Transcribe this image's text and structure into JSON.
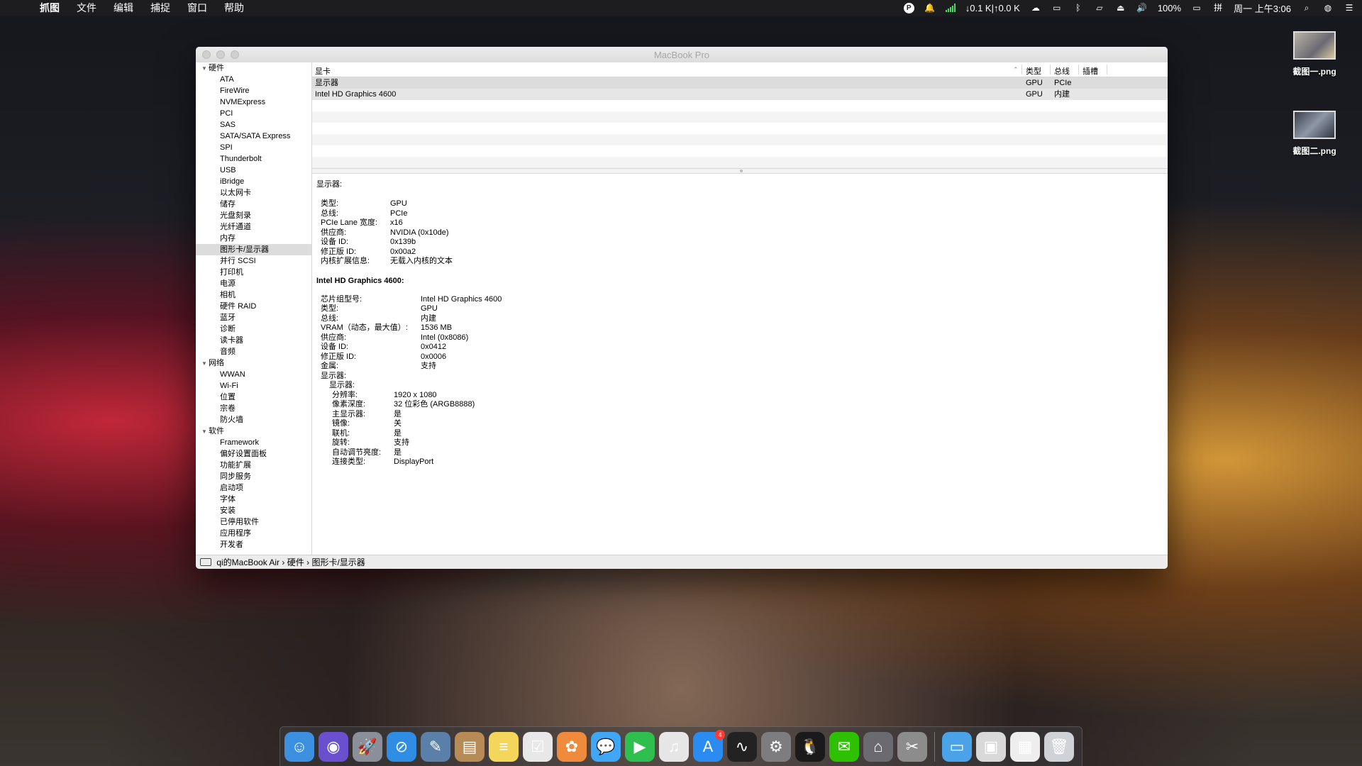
{
  "menubar": {
    "app": "抓图",
    "menus": [
      "文件",
      "编辑",
      "捕捉",
      "窗口",
      "帮助"
    ],
    "network": "↓0.1 K|↑0.0 K",
    "battery": "100%",
    "clock": "周一 上午3:06"
  },
  "desktop": {
    "files": [
      "截图一.png",
      "截图二.png"
    ]
  },
  "window": {
    "title": "MacBook Pro",
    "sidebar": {
      "groups": [
        {
          "label": "硬件",
          "items": [
            "ATA",
            "FireWire",
            "NVMExpress",
            "PCI",
            "SAS",
            "SATA/SATA Express",
            "SPI",
            "Thunderbolt",
            "USB",
            "iBridge",
            "以太网卡",
            "储存",
            "光盘刻录",
            "光纤通道",
            "内存",
            "图形卡/显示器",
            "并行 SCSI",
            "打印机",
            "电源",
            "相机",
            "硬件 RAID",
            "蓝牙",
            "诊断",
            "读卡器",
            "音频"
          ]
        },
        {
          "label": "网络",
          "items": [
            "WWAN",
            "Wi-Fi",
            "位置",
            "宗卷",
            "防火墙"
          ]
        },
        {
          "label": "软件",
          "items": [
            "Framework",
            "偏好设置面板",
            "功能扩展",
            "同步服务",
            "启动项",
            "字体",
            "安装",
            "已停用软件",
            "应用程序",
            "开发者"
          ]
        }
      ],
      "selected": "图形卡/显示器"
    },
    "table": {
      "headers": {
        "name": "显卡",
        "type": "类型",
        "bus": "总线",
        "slot": "插槽"
      },
      "rows": [
        {
          "name": "显示器",
          "type": "GPU",
          "bus": "PCIe"
        },
        {
          "name": "Intel HD Graphics 4600",
          "type": "GPU",
          "bus": "内建"
        }
      ]
    },
    "detail": {
      "section1_title": "显示器:",
      "section1": [
        {
          "k": "类型:",
          "v": "GPU"
        },
        {
          "k": "总线:",
          "v": "PCIe"
        },
        {
          "k": "PCIe Lane 宽度:",
          "v": "x16"
        },
        {
          "k": "供应商:",
          "v": "NVIDIA (0x10de)"
        },
        {
          "k": "设备 ID:",
          "v": "0x139b"
        },
        {
          "k": "修正版 ID:",
          "v": "0x00a2"
        },
        {
          "k": "内核扩展信息:",
          "v": "无载入内核的文本"
        }
      ],
      "section2_title": "Intel HD Graphics 4600:",
      "section2": [
        {
          "k": "芯片组型号:",
          "v": "Intel HD Graphics 4600"
        },
        {
          "k": "类型:",
          "v": "GPU"
        },
        {
          "k": "总线:",
          "v": "内建"
        },
        {
          "k": "VRAM（动态，最大值）:",
          "v": "1536 MB"
        },
        {
          "k": "供应商:",
          "v": "Intel (0x8086)"
        },
        {
          "k": "设备 ID:",
          "v": "0x0412"
        },
        {
          "k": "修正版 ID:",
          "v": "0x0006"
        },
        {
          "k": "金属:",
          "v": "支持"
        }
      ],
      "displays_label": "显示器:",
      "display_label": "显示器:",
      "display": [
        {
          "k": "分辨率:",
          "v": "1920 x 1080"
        },
        {
          "k": "像素深度:",
          "v": "32 位彩色 (ARGB8888)"
        },
        {
          "k": "主显示器:",
          "v": "是"
        },
        {
          "k": "镜像:",
          "v": "关"
        },
        {
          "k": "联机:",
          "v": "是"
        },
        {
          "k": "旋转:",
          "v": "支持"
        },
        {
          "k": "自动调节亮度:",
          "v": "是"
        },
        {
          "k": "连接类型:",
          "v": "DisplayPort"
        }
      ]
    },
    "pathbar": {
      "computer": "qi的MacBook Air",
      "crumb1": "硬件",
      "crumb2": "图形卡/显示器"
    }
  },
  "dock": {
    "apps": [
      {
        "name": "finder-icon",
        "glyph": "☺",
        "color": "#3d8fe0"
      },
      {
        "name": "siri-icon",
        "glyph": "◉",
        "color": "#6a4fcf"
      },
      {
        "name": "launchpad-icon",
        "glyph": "🚀",
        "color": "#8a8f99"
      },
      {
        "name": "safari-icon",
        "glyph": "⊘",
        "color": "#2f8de4"
      },
      {
        "name": "preview-icon",
        "glyph": "✎",
        "color": "#5a7fa8"
      },
      {
        "name": "contacts-icon",
        "glyph": "▤",
        "color": "#b88a55"
      },
      {
        "name": "notes-icon",
        "glyph": "≡",
        "color": "#f3d65a"
      },
      {
        "name": "reminders-icon",
        "glyph": "☑",
        "color": "#e8e8e8"
      },
      {
        "name": "photos-icon",
        "glyph": "✿",
        "color": "#f08a3c"
      },
      {
        "name": "messages-icon",
        "glyph": "💬",
        "color": "#3fa7f5"
      },
      {
        "name": "facetime-icon",
        "glyph": "▶",
        "color": "#2fbf4f"
      },
      {
        "name": "itunes-icon",
        "glyph": "♫",
        "color": "#e6e6e6"
      },
      {
        "name": "app-store-icon",
        "glyph": "A",
        "color": "#2a8cf0",
        "badge": "4"
      },
      {
        "name": "activity-monitor-icon",
        "glyph": "∿",
        "color": "#222"
      },
      {
        "name": "system-preferences-icon",
        "glyph": "⚙",
        "color": "#7d7d80"
      },
      {
        "name": "qq-icon",
        "glyph": "🐧",
        "color": "#1a1a1a"
      },
      {
        "name": "wechat-icon",
        "glyph": "✉",
        "color": "#2dc100"
      },
      {
        "name": "system-information-icon",
        "glyph": "⌂",
        "color": "#6a6a70"
      },
      {
        "name": "screenshot-app-icon",
        "glyph": "✂",
        "color": "#8c8c8c"
      }
    ],
    "after_sep": [
      {
        "name": "folder-icon",
        "glyph": "▭",
        "color": "#4aa3e8"
      },
      {
        "name": "screenshot-stack-icon",
        "glyph": "▣",
        "color": "#d9d9d9"
      },
      {
        "name": "calendar-grid-icon",
        "glyph": "▦",
        "color": "#eeeeee"
      },
      {
        "name": "trash-icon",
        "glyph": "🗑",
        "color": "#cfd2d6"
      }
    ]
  }
}
